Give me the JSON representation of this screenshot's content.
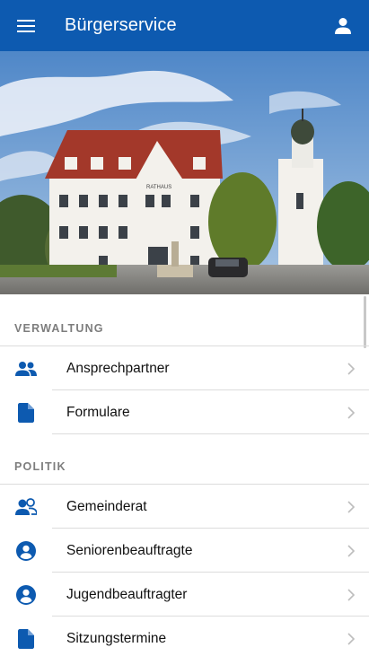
{
  "app": {
    "title": "Bürgerservice",
    "accent": "#0d5ab0",
    "icons": {
      "menu": "menu-icon",
      "account": "account-icon"
    }
  },
  "hero": {
    "sign_text": "RATHAUS"
  },
  "sections": [
    {
      "header": "VERWALTUNG",
      "items": [
        {
          "label": "Ansprechpartner",
          "icon": "people-icon"
        },
        {
          "label": "Formulare",
          "icon": "document-icon"
        }
      ]
    },
    {
      "header": "POLITIK",
      "items": [
        {
          "label": "Gemeinderat",
          "icon": "council-icon"
        },
        {
          "label": "Seniorenbeauftragte",
          "icon": "person-circle-icon"
        },
        {
          "label": "Jugendbeauftragter",
          "icon": "person-circle-icon"
        },
        {
          "label": "Sitzungstermine",
          "icon": "document-icon"
        }
      ]
    }
  ]
}
